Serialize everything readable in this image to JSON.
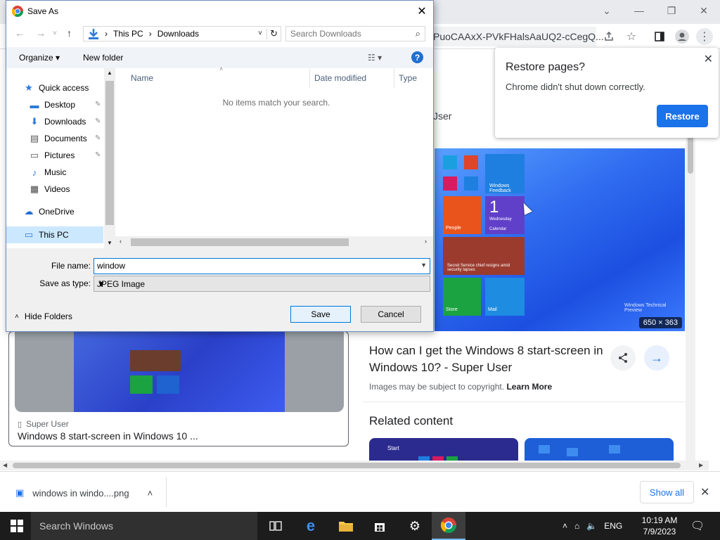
{
  "chrome": {
    "url_fragment": "PuoCAAxX-PVkFHalsAaUQ2-cCegQ...",
    "minimize": "—",
    "maximize": "❐",
    "close": "✕",
    "tab_search": "⌄"
  },
  "page": {
    "left_result": {
      "source": "Super User",
      "caption": "Windows 8 start-screen in Windows 10 ..."
    },
    "user_label": "Jser",
    "image_size": "650 × 363",
    "result_title": "How can I get the Windows 8 start-screen in Windows 10? - Super User",
    "copyright_text": "Images may be subject to copyright.",
    "learn_more": "Learn More",
    "related_title": "Related content",
    "tile_calendar_day": "1",
    "tile_calendar_label": "Wednesday",
    "tile_calendar_app": "Calendar",
    "tile_people": "People",
    "tile_store": "Store",
    "tile_mail": "Mail",
    "tile_feedback": "Windows Feedback",
    "tile_news": "Secret Service chief resigns amid security lapses",
    "watermark": "Windows Technical Preview",
    "related_start": "Start"
  },
  "restore_popup": {
    "title": "Restore pages?",
    "message": "Chrome didn't shut down correctly.",
    "button": "Restore"
  },
  "download_shelf": {
    "file_name": "windows in windo....png",
    "show_all": "Show all"
  },
  "dialog": {
    "title": "Save As",
    "path": [
      "This PC",
      "Downloads"
    ],
    "search_placeholder": "Search Downloads",
    "organize": "Organize ▾",
    "new_folder": "New folder",
    "nav_items": [
      {
        "label": "Quick access",
        "icon": "star-icon"
      },
      {
        "label": "Desktop",
        "icon": "desktop-icon"
      },
      {
        "label": "Downloads",
        "icon": "download-icon"
      },
      {
        "label": "Documents",
        "icon": "document-icon"
      },
      {
        "label": "Pictures",
        "icon": "picture-icon"
      },
      {
        "label": "Music",
        "icon": "music-icon"
      },
      {
        "label": "Videos",
        "icon": "video-icon"
      },
      {
        "label": "OneDrive",
        "icon": "cloud-icon"
      },
      {
        "label": "This PC",
        "icon": "computer-icon"
      }
    ],
    "columns": [
      "Name",
      "Date modified",
      "Type"
    ],
    "empty_message": "No items match your search.",
    "file_name_label": "File name:",
    "file_name_value": "window",
    "save_type_label": "Save as type:",
    "save_type_value": "JPEG Image",
    "hide_folders": "Hide Folders",
    "save": "Save",
    "cancel": "Cancel"
  },
  "taskbar": {
    "search_placeholder": "Search Windows",
    "language": "ENG",
    "time": "10:19 AM",
    "date": "7/9/2023"
  },
  "colors": {
    "chrome_blue": "#1a73e8",
    "dialog_border": "#6c8ebf",
    "taskbar": "#1c1c1c",
    "selection": "#cce8ff"
  }
}
